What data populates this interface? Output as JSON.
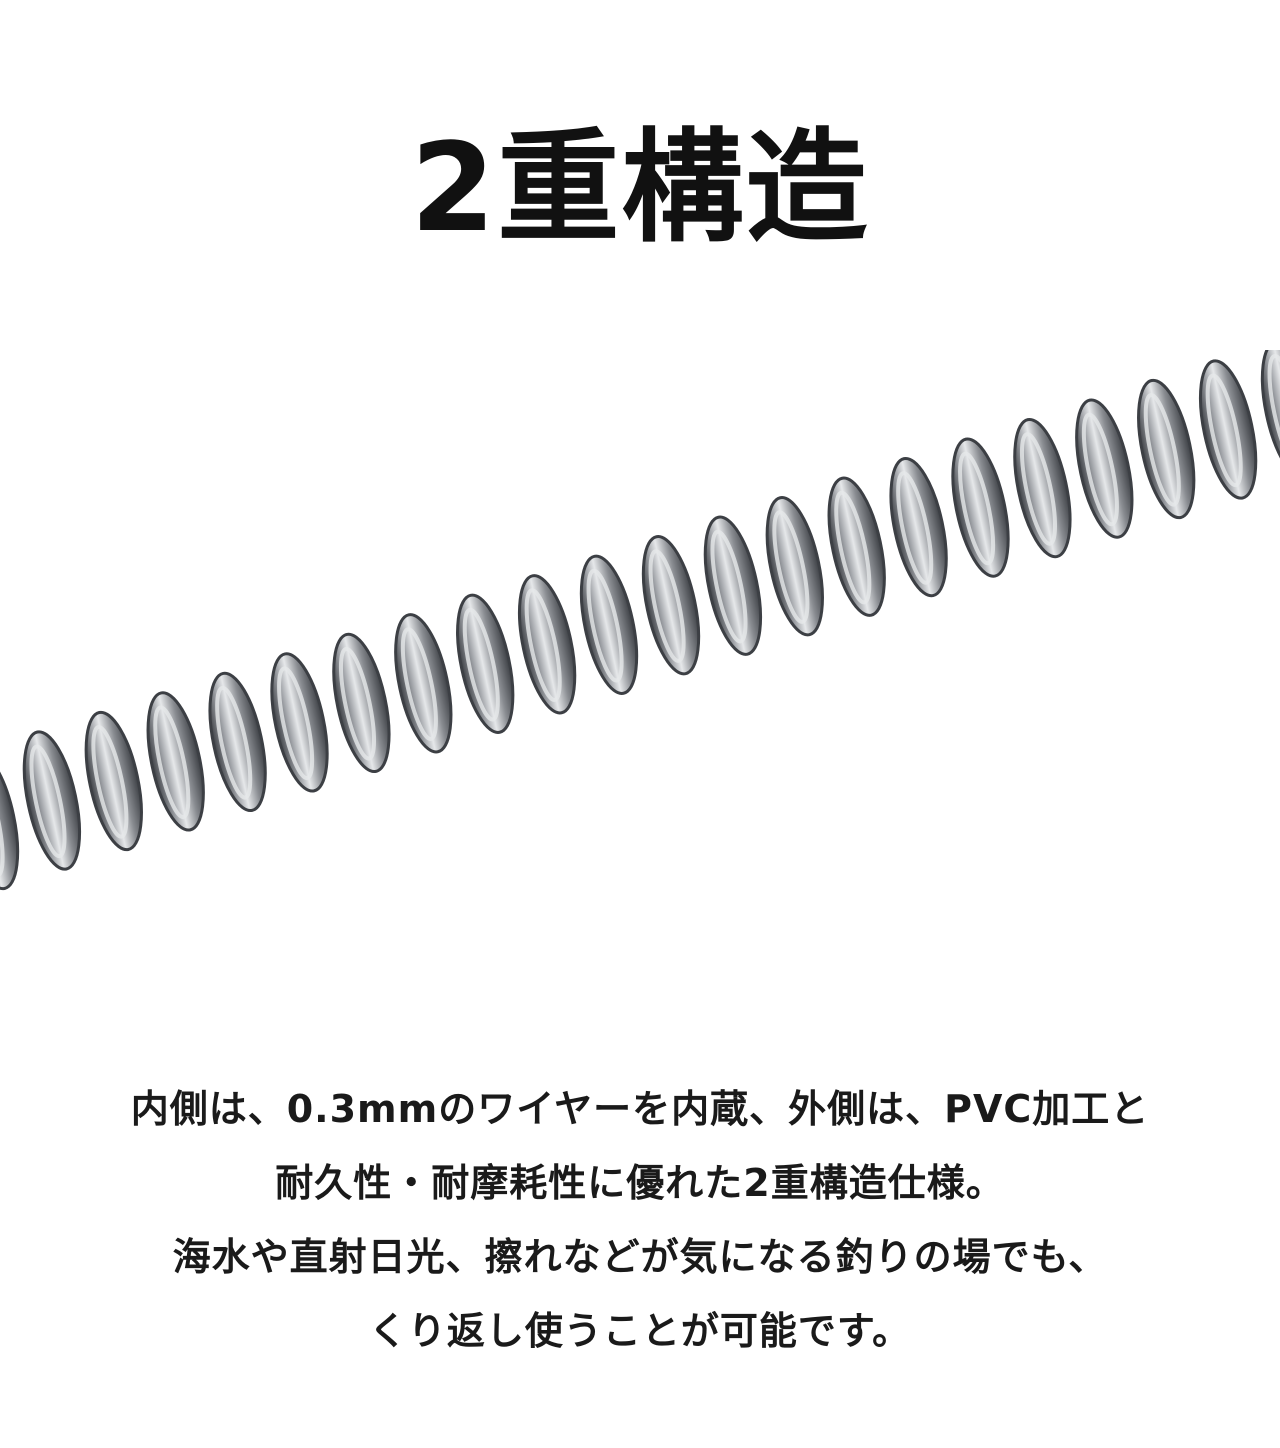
{
  "page": {
    "title": "2重構造",
    "description_lines": [
      "内側は、0.3mmのワイヤーを内蔵、外側は、PVC加工と",
      "耐久性・耐摩耗性に優れた2重構造仕様。",
      "海水や直射日光、擦れなどが気になる釣りの場でも、",
      "くり返し使うことが可能です。"
    ]
  },
  "image": {
    "icon": "coiled-spring-wire",
    "coil_color": "#8a8d92",
    "highlight_color": "#e6e8ea",
    "shadow_color": "#3c3f44"
  }
}
